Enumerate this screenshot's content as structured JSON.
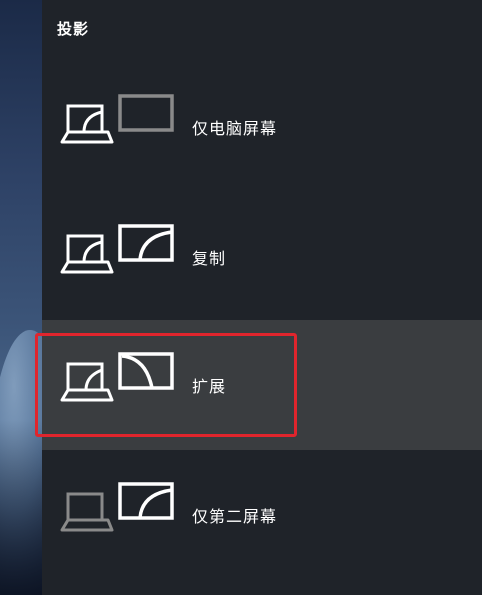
{
  "panel": {
    "title": "投影",
    "options": [
      {
        "label": "仅电脑屏幕",
        "icon": "pc-screen-only-icon"
      },
      {
        "label": "复制",
        "icon": "duplicate-icon"
      },
      {
        "label": "扩展",
        "icon": "extend-icon",
        "state": "hover"
      },
      {
        "label": "仅第二屏幕",
        "icon": "second-screen-only-icon"
      }
    ]
  },
  "colors": {
    "panel_bg": "#1f2329",
    "hover_bg": "#3a3d40",
    "icon_active": "#ffffff",
    "icon_dim": "#8a8a8a",
    "highlight": "#e0252d"
  }
}
